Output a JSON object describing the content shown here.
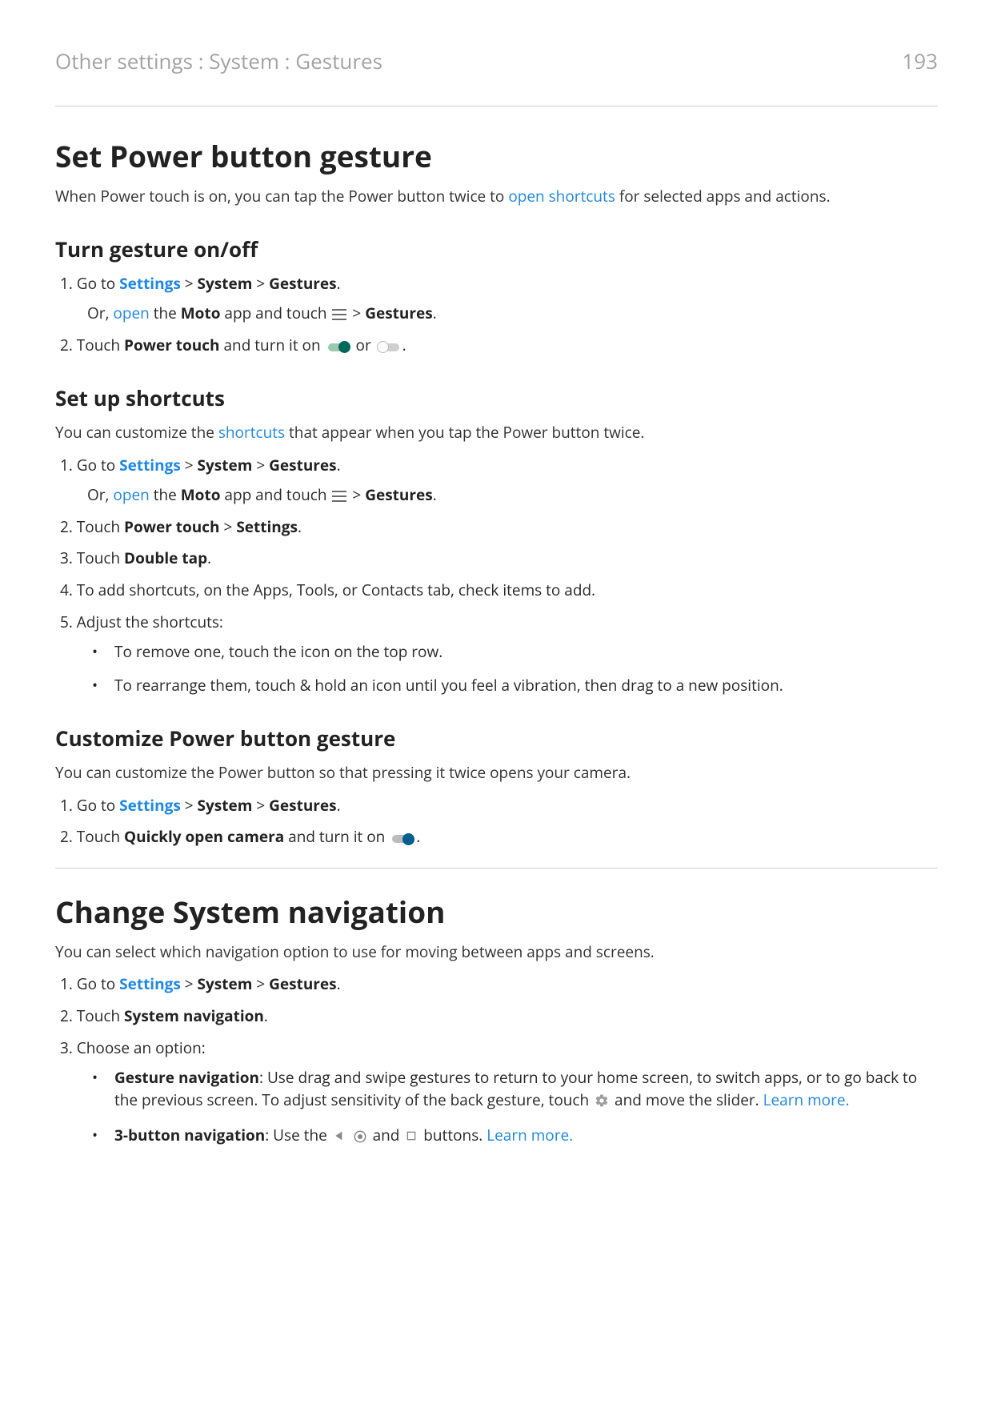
{
  "header": {
    "breadcrumb": "Other settings : System : Gestures",
    "page_number": "193"
  },
  "s1": {
    "title": "Set Power button gesture",
    "intro_a": "When Power touch is on, you can tap the Power button twice to ",
    "intro_link": "open shortcuts",
    "intro_b": " for selected apps and actions.",
    "h_turn": "Turn gesture on/off",
    "step1_goto": "Go to ",
    "settings": "Settings",
    "gt": " > ",
    "system": "System",
    "gestures": "Gestures",
    "period": ".",
    "step1_or_a": "Or, ",
    "open": "open",
    "step1_or_b": " the ",
    "moto": "Moto",
    "step1_or_c": " app and touch ",
    "step1_or_d": " > ",
    "step1_or_e": ".",
    "step2_a": "Touch ",
    "step2_b": "Power touch",
    "step2_c": " and turn it on ",
    "step2_or": " or ",
    "h_shortcuts": "Set up shortcuts",
    "shortcuts_intro_a": "You can customize the ",
    "shortcuts_link": "shortcuts",
    "shortcuts_intro_b": " that appear when you tap the Power button twice.",
    "ss2_a": "Touch ",
    "ss2_b": "Power touch",
    "ss2_c": " > ",
    "ss2_d": "Settings",
    "ss3_a": "Touch ",
    "ss3_b": "Double tap",
    "ss4": "To add shortcuts, on the Apps, Tools, or Contacts tab, check items to add.",
    "ss5": "Adjust the shortcuts:",
    "ss5_b1": "To remove one, touch the icon on the top row.",
    "ss5_b2": "To rearrange them, touch & hold an icon until you feel a vibration, then drag to a new position.",
    "h_customize": "Customize Power button gesture",
    "cust_intro": "You can customize the Power button so that pressing it twice opens your camera.",
    "cust2_a": "Touch ",
    "cust2_b": "Quickly open camera",
    "cust2_c": " and turn it on "
  },
  "s2": {
    "title": "Change System navigation",
    "intro": "You can select which navigation option to use for moving between apps and screens.",
    "step2_a": "Touch ",
    "step2_b": "System navigation",
    "step3": "Choose an option:",
    "opt1_a": "Gesture navigation",
    "opt1_b": ": Use drag and swipe gestures to return to your home screen, to switch apps, or to go back to the previous screen. To adjust sensitivity of the back gesture, touch ",
    "opt1_c": " and move the slider. ",
    "learn": "Learn more.",
    "opt2_a": "3-button navigation",
    "opt2_b": ": Use the ",
    "opt2_c": " and ",
    "opt2_d": " buttons. "
  }
}
